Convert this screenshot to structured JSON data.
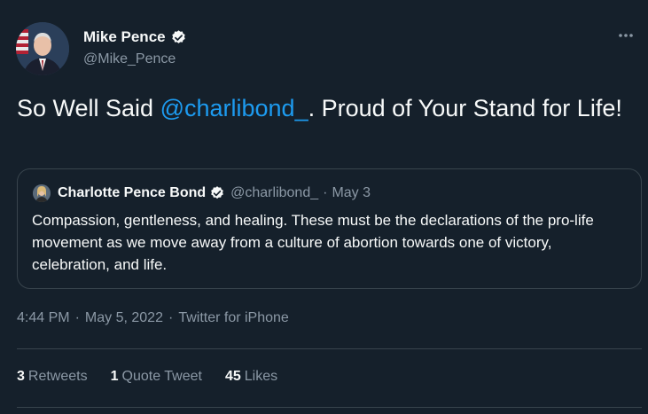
{
  "author": {
    "name": "Mike Pence",
    "handle": "@Mike_Pence"
  },
  "tweet": {
    "text_before": "So Well Said ",
    "mention": "@charlibond_",
    "text_after": ". Proud of Your Stand for Life!"
  },
  "quoted_tweet": {
    "name": "Charlotte Pence Bond",
    "handle": "@charlibond_",
    "dot": "·",
    "date": "May 3",
    "text": "Compassion, gentleness, and healing. These must be the declarations of the pro-life movement as we move away from a culture of abortion towards one of victory, celebration, and life."
  },
  "meta": {
    "time": "4:44 PM",
    "sep1": "·",
    "date": "May 5, 2022",
    "sep2": "·",
    "source": "Twitter for iPhone"
  },
  "stats": {
    "retweets_count": "3",
    "retweets_label": "Retweets",
    "quotes_count": "1",
    "quotes_label": "Quote Tweet",
    "likes_count": "45",
    "likes_label": "Likes"
  },
  "colors": {
    "background": "#15202b",
    "accent": "#1d9bf0",
    "muted": "#8b98a5",
    "border": "#38444d"
  },
  "icons": {
    "verified": "verified-badge-icon",
    "more": "more-icon"
  }
}
